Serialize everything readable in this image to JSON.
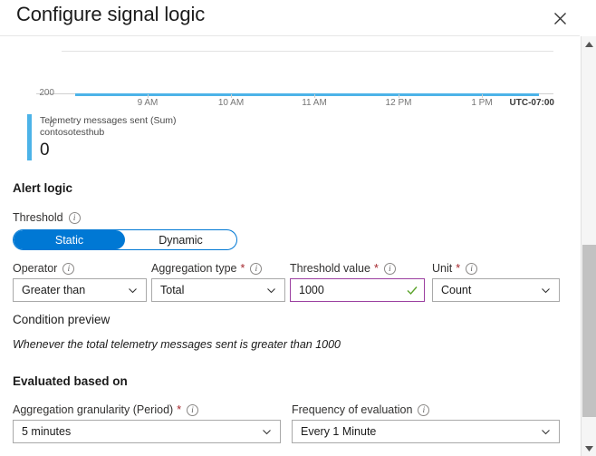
{
  "header": {
    "title": "Configure signal logic",
    "close_icon": "close-icon"
  },
  "chart": {
    "legend": {
      "metric": "Telemetry messages sent (Sum)",
      "resource": "contosotesthub",
      "value": "0",
      "color": "#4cb3e8"
    },
    "timezone_label": "UTC-07:00"
  },
  "chart_data": {
    "type": "line",
    "title": "Telemetry messages sent (Sum)",
    "subtitle": "contosotesthub",
    "xlabel": "",
    "ylabel": "",
    "x": [
      "9 AM",
      "10 AM",
      "11 AM",
      "12 PM",
      "1 PM"
    ],
    "tick_positions_pct": [
      17.5,
      34.5,
      51.5,
      68.5,
      85.5
    ],
    "series": [
      {
        "name": "Telemetry messages sent (Sum)",
        "resource": "contosotesthub",
        "color": "#4cb3e8",
        "values": [
          0,
          0,
          0,
          0,
          0
        ],
        "current_value": 0
      }
    ],
    "ylim": [
      0,
      200
    ],
    "yticks": [
      0,
      200
    ],
    "ytick_labels": [
      "0",
      "200"
    ],
    "grid": true,
    "legend_position": "bottom-left",
    "timezone": "UTC-07:00"
  },
  "alert_logic": {
    "heading": "Alert logic",
    "threshold": {
      "label": "Threshold",
      "info_icon": "info-icon",
      "options": [
        "Static",
        "Dynamic"
      ],
      "selected": "Static",
      "accent_color": "#0078d4"
    },
    "operator": {
      "label": "Operator",
      "info_icon": "info-icon",
      "value": "Greater than",
      "required": false
    },
    "aggregation_type": {
      "label": "Aggregation type",
      "info_icon": "info-icon",
      "value": "Total",
      "required": true,
      "required_mark": "*"
    },
    "threshold_value": {
      "label": "Threshold value",
      "info_icon": "info-icon",
      "value": "1000",
      "required": true,
      "required_mark": "*",
      "valid_icon": "checkmark-icon",
      "border_color": "#9b3fa0",
      "valid_color": "#5ba32b"
    },
    "unit": {
      "label": "Unit",
      "info_icon": "info-icon",
      "value": "Count",
      "required": true,
      "required_mark": "*"
    },
    "condition_preview": {
      "label": "Condition preview",
      "text": "Whenever the total telemetry messages sent is greater than 1000"
    }
  },
  "evaluated_based_on": {
    "heading": "Evaluated based on",
    "aggregation_granularity": {
      "label": "Aggregation granularity (Period)",
      "info_icon": "info-icon",
      "value": "5 minutes",
      "required": true,
      "required_mark": "*"
    },
    "frequency_of_evaluation": {
      "label": "Frequency of evaluation",
      "info_icon": "info-icon",
      "value": "Every 1 Minute",
      "required": false
    }
  },
  "scrollbar": {
    "up_icon": "chevron-up-icon",
    "down_icon": "chevron-down-icon"
  }
}
